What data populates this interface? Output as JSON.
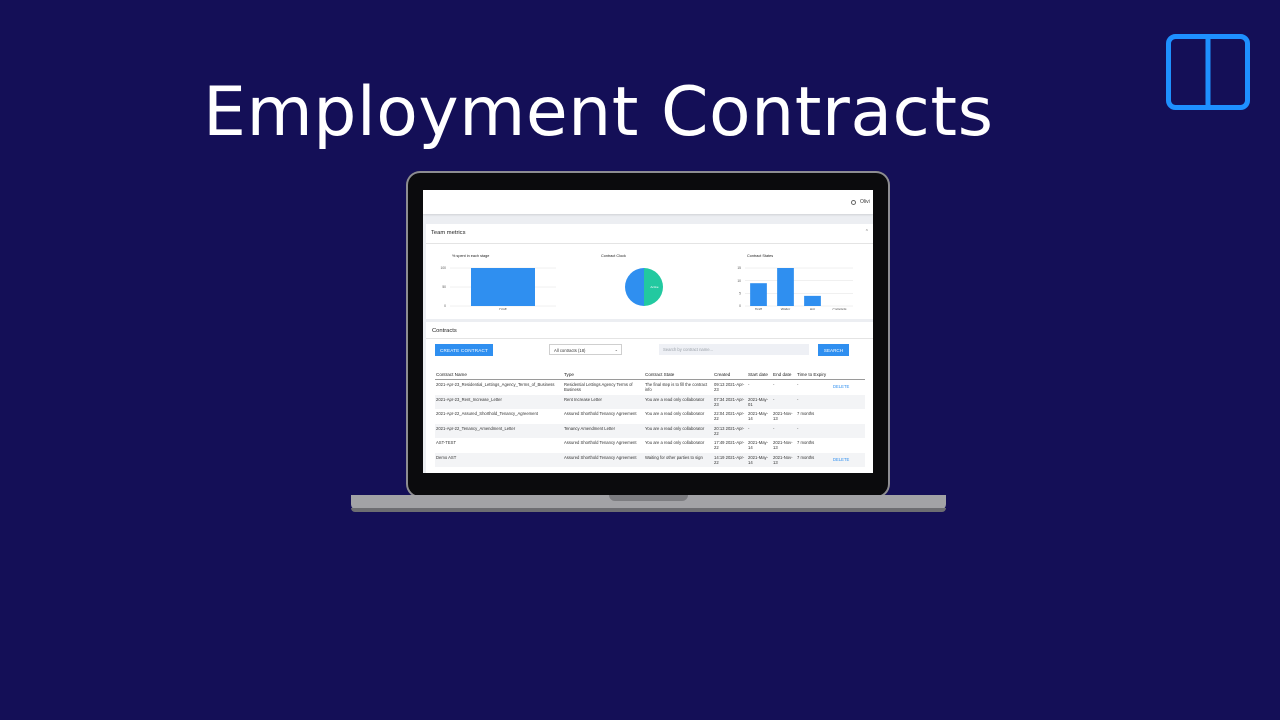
{
  "headline": "Employment Contracts",
  "colors": {
    "background": "#140f57",
    "accent": "#2f8ff0",
    "pie_teal": "#22c9a0",
    "logo_blue": "#1e90ff"
  },
  "app": {
    "user_name": "Olivi",
    "team_metrics": {
      "title": "Team metrics",
      "collapse_icon": "chevron-up-icon",
      "charts": [
        {
          "type": "bar",
          "title": "% spent in each stage",
          "categories": [
            "Draft"
          ],
          "values": [
            100
          ],
          "yticks": [
            0,
            50,
            100
          ],
          "ylim": [
            0,
            100
          ]
        },
        {
          "type": "pie",
          "title": "Contract Clock",
          "slices": [
            {
              "label": "",
              "value": 50,
              "color": "#22c9a0"
            },
            {
              "label": "Active",
              "value": 50,
              "color": "#2f8ff0"
            }
          ]
        },
        {
          "type": "bar",
          "title": "Contract States",
          "categories": [
            "Draft",
            "Waiter",
            "Agr",
            "Complete"
          ],
          "values": [
            9,
            15,
            4,
            0
          ],
          "yticks": [
            0,
            5,
            10,
            15
          ],
          "ylim": [
            0,
            15
          ]
        }
      ]
    },
    "contracts": {
      "title": "Contracts",
      "create_label": "CREATE CONTRACT",
      "filter_value": "All contracts (18)",
      "search_placeholder": "Search by contract name...",
      "search_label": "SEARCH",
      "columns": [
        "Contract Name",
        "Type",
        "Contract State",
        "Created",
        "Start date",
        "End date",
        "Time to Expiry",
        ""
      ],
      "rows": [
        [
          "2021-Apr-23_Residential_Lettings_Agency_Terms_of_Business",
          "Residential Lettings Agency Terms of Business",
          "The final step is to fill the contract info",
          "09:13 2021-Apr-23",
          "-",
          "-",
          "-",
          "DELETE"
        ],
        [
          "2021-Apr-23_Rent_Increase_Letter",
          "Rent Increase Letter",
          "You are a read only collaborator",
          "07:34 2021-Apr-23",
          "2021-May-01",
          "-",
          "-",
          ""
        ],
        [
          "2021-Apr-22_Assured_Shorthold_Tenancy_Agreement",
          "Assured Shorthold Tenancy Agreement",
          "You are a read only collaborator",
          "22:04 2021-Apr-22",
          "2021-May-14",
          "2021-Nov-13",
          "7 months",
          ""
        ],
        [
          "2021-Apr-22_Tenancy_Amendment_Letter",
          "Tenancy Amendment Letter",
          "You are a read only collaborator",
          "20:13 2021-Apr-22",
          "-",
          "-",
          "-",
          ""
        ],
        [
          "AST-TEST",
          "Assured Shorthold Tenancy Agreement",
          "You are a read only collaborator",
          "17:49 2021-Apr-22",
          "2021-May-14",
          "2021-Nov-13",
          "7 months",
          ""
        ],
        [
          "Demo AST",
          "Assured Shorthold Tenancy Agreement",
          "Waiting for other parties to sign",
          "14:19 2021-Apr-22",
          "2021-May-14",
          "2021-Nov-13",
          "7 months",
          "DELETE"
        ]
      ]
    }
  }
}
